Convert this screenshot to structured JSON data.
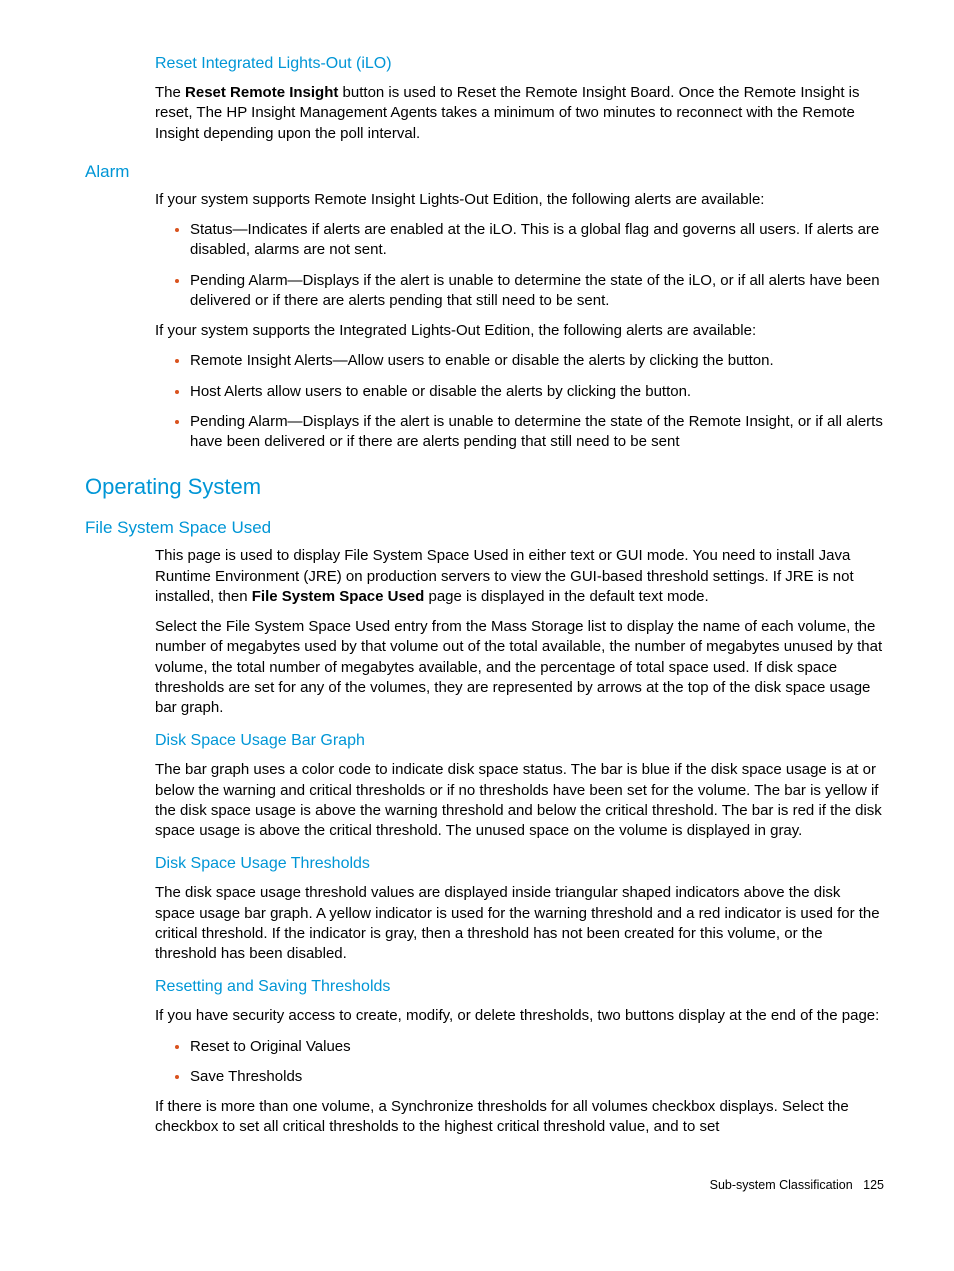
{
  "sections": {
    "reset_ilo": {
      "title": "Reset Integrated Lights-Out (iLO)",
      "para1_a": "The ",
      "para1_b": "Reset Remote Insight",
      "para1_c": " button is used to Reset the Remote Insight Board. Once the Remote Insight is reset, The HP Insight Management Agents takes a minimum of two minutes to reconnect with the Remote Insight depending upon the poll interval."
    },
    "alarm": {
      "title": "Alarm",
      "para1": "If your system supports Remote Insight Lights-Out Edition, the following alerts are available:",
      "bullets1": [
        "Status—Indicates if alerts are enabled at the iLO. This is a global flag and governs all users. If alerts are disabled, alarms are not sent.",
        "Pending Alarm—Displays if the alert is unable to determine the state of the iLO, or if all alerts have been delivered or if there are alerts pending that still need to be sent."
      ],
      "para2": "If your system supports the Integrated Lights-Out Edition, the following alerts are available:",
      "bullets2": [
        "Remote Insight Alerts—Allow users to enable or disable the alerts by clicking the button.",
        "Host Alerts allow users to enable or disable the alerts by clicking the button.",
        "Pending Alarm—Displays if the alert is unable to determine the state of the Remote Insight, or if all alerts have been delivered or if there are alerts pending that still need to be sent"
      ]
    },
    "os": {
      "title": "Operating System"
    },
    "fss": {
      "title": "File System Space Used",
      "para1_a": "This page is used to display File System Space Used in either text or GUI mode. You need to install Java Runtime Environment (JRE) on production servers to view the GUI-based threshold settings. If JRE is not installed, then ",
      "para1_b": "File System Space Used",
      "para1_c": " page is displayed in the default text mode.",
      "para2": "Select the File System Space Used entry from the Mass Storage list to display the name of each volume, the number of megabytes used by that volume out of the total available, the number of megabytes unused by that volume, the total number of megabytes available, and the percentage of total space used. If disk space thresholds are set for any of the volumes, they are represented by arrows at the top of the disk space usage bar graph."
    },
    "bargraph": {
      "title": "Disk Space Usage Bar Graph",
      "para1": "The bar graph uses a color code to indicate disk space status. The bar is blue if the disk space usage is at or below the warning and critical thresholds or if no thresholds have been set for the volume. The bar is yellow if the disk space usage is above the warning threshold and below the critical threshold. The bar is red if the disk space usage is above the critical threshold. The unused space on the volume is displayed in gray."
    },
    "thresholds": {
      "title": "Disk Space Usage Thresholds",
      "para1": "The disk space usage threshold values are displayed inside triangular shaped indicators above the disk space usage bar graph. A yellow indicator is used for the warning threshold and a red indicator is used for the critical threshold. If the indicator is gray, then a threshold has not been created for this volume, or the threshold has been disabled."
    },
    "reset_save": {
      "title": "Resetting and Saving Thresholds",
      "para1": "If you have security access to create, modify, or delete thresholds, two buttons display at the end of the page:",
      "bullets": [
        "Reset to Original Values",
        "Save Thresholds"
      ],
      "para2": "If there is more than one volume, a Synchronize thresholds for all volumes checkbox displays. Select the checkbox to set all critical thresholds to the highest critical threshold value, and to set"
    }
  },
  "footer": {
    "label": "Sub-system Classification",
    "page": "125"
  }
}
